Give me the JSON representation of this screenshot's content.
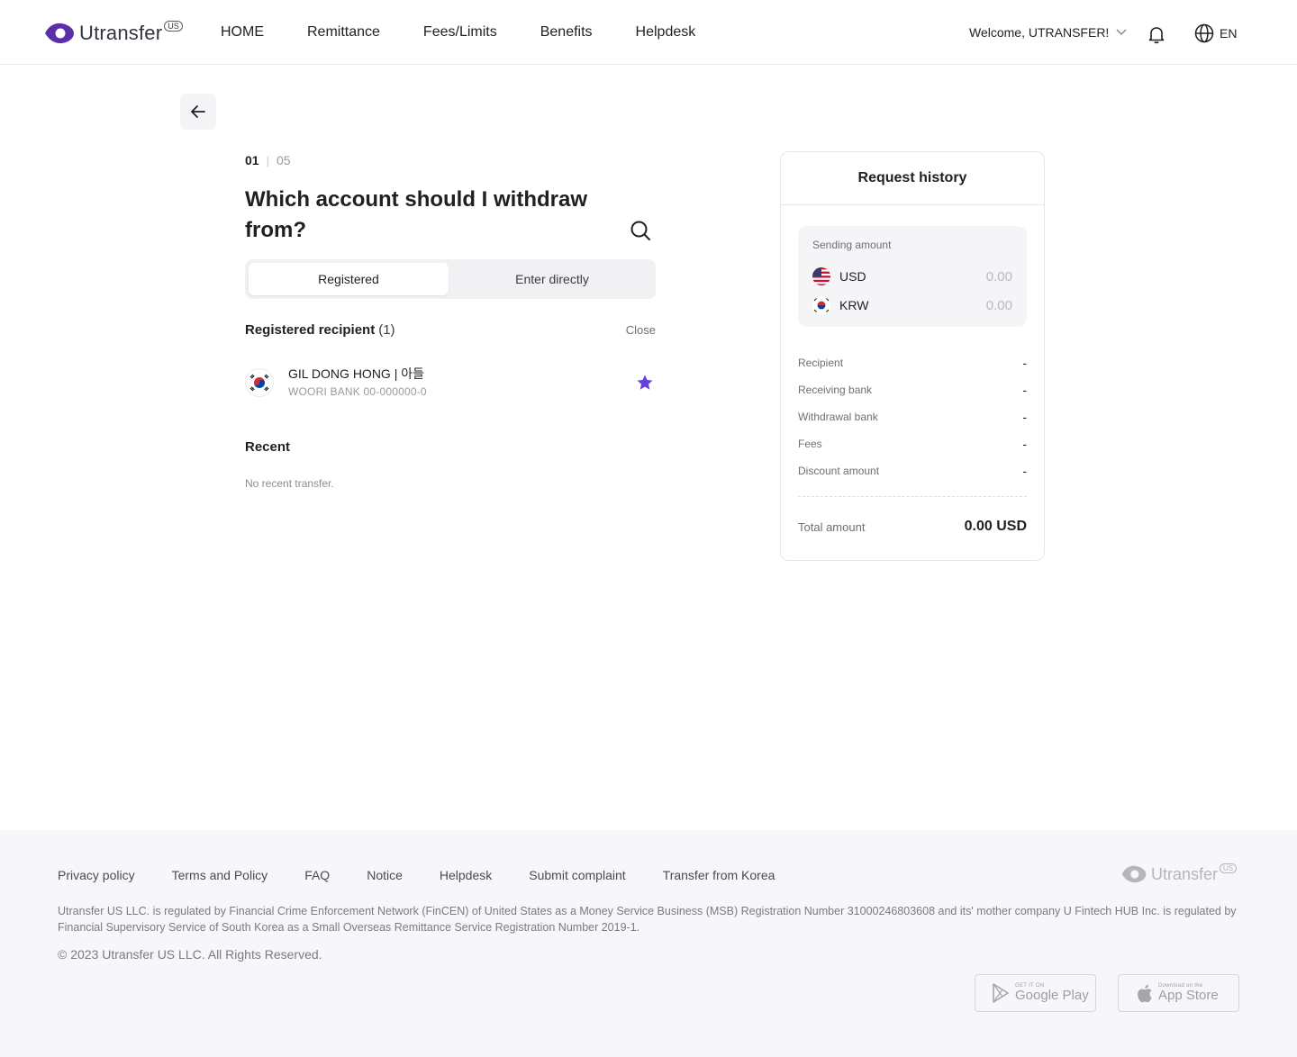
{
  "header": {
    "logo_text": "Utransfer",
    "logo_badge": "US",
    "nav": [
      "HOME",
      "Remittance",
      "Fees/Limits",
      "Benefits",
      "Helpdesk"
    ],
    "welcome": "Welcome, UTRANSFER!",
    "language": "EN"
  },
  "colors": {
    "brand": "#5b2fa8",
    "star": "#6a3fe0"
  },
  "main": {
    "step_current": "01",
    "step_separator": "|",
    "step_total": "05",
    "title": "Which account should I withdraw from?",
    "tabs": {
      "registered": "Registered",
      "enter_directly": "Enter directly"
    },
    "registered_heading": "Registered recipient",
    "registered_count": "(1)",
    "close_label": "Close",
    "recipient": {
      "name": "GIL DONG HONG | 아들",
      "account": "WOORI BANK  00-000000-0"
    },
    "recent_heading": "Recent",
    "recent_empty": "No recent transfer."
  },
  "history": {
    "title": "Request history",
    "sending_label": "Sending amount",
    "usd_code": "USD",
    "usd_amount": "0.00",
    "krw_code": "KRW",
    "krw_amount": "0.00",
    "rows": [
      {
        "label": "Recipient",
        "value": "-"
      },
      {
        "label": "Receiving bank",
        "value": "-"
      },
      {
        "label": "Withdrawal bank",
        "value": "-"
      },
      {
        "label": "Fees",
        "value": "-"
      },
      {
        "label": "Discount amount",
        "value": "-"
      }
    ],
    "total_label": "Total amount",
    "total_value": "0.00 USD"
  },
  "footer": {
    "links": [
      "Privacy policy",
      "Terms and Policy",
      "FAQ",
      "Notice",
      "Helpdesk",
      "Submit complaint",
      "Transfer from Korea"
    ],
    "logo_text": "Utransfer",
    "logo_badge": "US",
    "legal": "Utransfer US LLC. is regulated by Financial Crime Enforcement Network (FinCEN) of United States as a Money Service Business (MSB) Registration Number 31000246803608 and its' mother company U Fintech HUB Inc. is regulated by Financial Supervisory Service of South Korea as a Small Overseas Remittance Service Registration Number 2019-1.",
    "copyright": "© 2023 Utransfer US LLC. All Rights Reserved.",
    "google_play_small": "GET IT ON",
    "google_play_big": "Google Play",
    "app_store_small": "Download on the",
    "app_store_big": "App Store"
  }
}
